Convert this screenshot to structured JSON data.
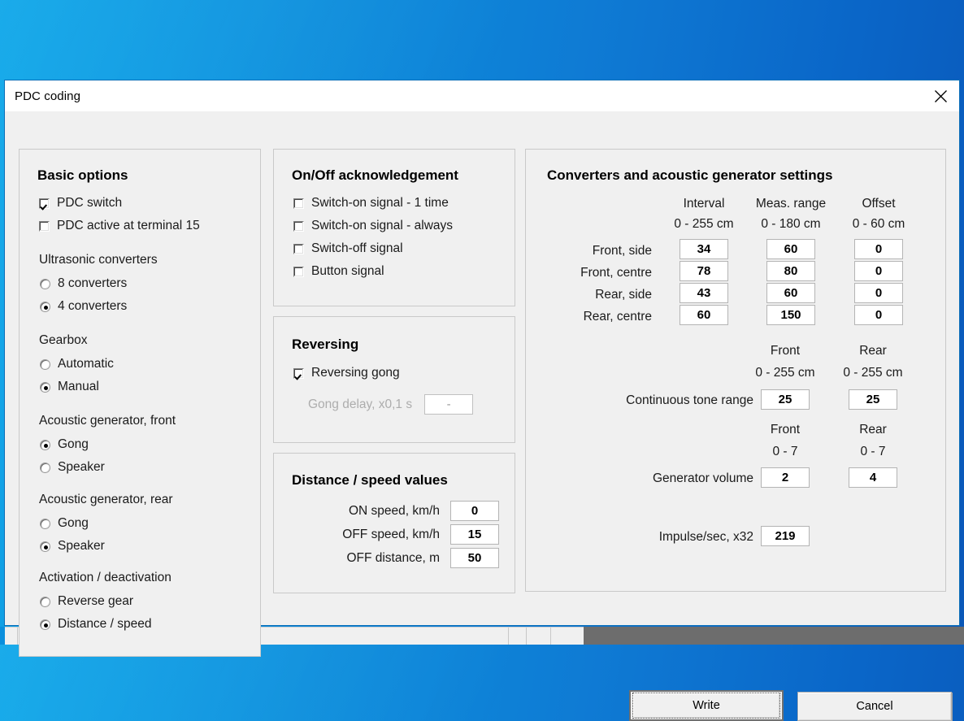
{
  "window": {
    "title": "PDC coding",
    "close_icon": "close-icon"
  },
  "basic_options": {
    "title": "Basic options",
    "checkboxes": [
      {
        "label": "PDC switch",
        "checked": true
      },
      {
        "label": "PDC active at terminal 15",
        "checked": false
      }
    ],
    "groups": [
      {
        "heading": "Ultrasonic converters",
        "options": [
          {
            "label": "8 converters",
            "selected": false
          },
          {
            "label": "4 converters",
            "selected": true
          }
        ]
      },
      {
        "heading": "Gearbox",
        "options": [
          {
            "label": "Automatic",
            "selected": false
          },
          {
            "label": "Manual",
            "selected": true
          }
        ]
      },
      {
        "heading": "Acoustic generator, front",
        "options": [
          {
            "label": "Gong",
            "selected": true
          },
          {
            "label": "Speaker",
            "selected": false
          }
        ]
      },
      {
        "heading": "Acoustic generator, rear",
        "options": [
          {
            "label": "Gong",
            "selected": false
          },
          {
            "label": "Speaker",
            "selected": true
          }
        ]
      },
      {
        "heading": "Activation / deactivation",
        "options": [
          {
            "label": "Reverse gear",
            "selected": false
          },
          {
            "label": "Distance / speed",
            "selected": true
          }
        ]
      }
    ]
  },
  "onoff": {
    "title": "On/Off acknowledgement",
    "checkboxes": [
      {
        "label": "Switch-on signal - 1 time",
        "checked": false
      },
      {
        "label": "Switch-on signal - always",
        "checked": false
      },
      {
        "label": "Switch-off signal",
        "checked": false
      },
      {
        "label": "Button signal",
        "checked": false
      }
    ]
  },
  "reversing": {
    "title": "Reversing",
    "checkbox": {
      "label": "Reversing gong",
      "checked": true
    },
    "gong_delay": {
      "label": "Gong delay, x0,1 s",
      "value": "-",
      "disabled": true
    }
  },
  "distance_speed": {
    "title": "Distance / speed values",
    "rows": [
      {
        "label": "ON speed, km/h",
        "value": "0"
      },
      {
        "label": "OFF speed, km/h",
        "value": "15"
      },
      {
        "label": "OFF distance, m",
        "value": "50"
      }
    ]
  },
  "converters": {
    "title": "Converters and acoustic generator settings",
    "columns": [
      {
        "name": "Interval",
        "range": "0 - 255 cm"
      },
      {
        "name": "Meas. range",
        "range": "0 - 180 cm"
      },
      {
        "name": "Offset",
        "range": "0 - 60 cm"
      }
    ],
    "rows": [
      {
        "label": "Front, side",
        "interval": "34",
        "meas_range": "60",
        "offset": "0"
      },
      {
        "label": "Front, centre",
        "interval": "78",
        "meas_range": "80",
        "offset": "0"
      },
      {
        "label": "Rear, side",
        "interval": "43",
        "meas_range": "60",
        "offset": "0"
      },
      {
        "label": "Rear, centre",
        "interval": "60",
        "meas_range": "150",
        "offset": "0"
      }
    ],
    "tone": {
      "label": "Continuous tone range",
      "col_front": "Front",
      "col_rear": "Rear",
      "range_front": "0 - 255 cm",
      "range_rear": "0 - 255 cm",
      "front": "25",
      "rear": "25"
    },
    "volume": {
      "label": "Generator volume",
      "col_front": "Front",
      "col_rear": "Rear",
      "range_front": "0 - 7",
      "range_rear": "0 - 7",
      "front": "2",
      "rear": "4"
    },
    "impulse": {
      "label": "Impulse/sec, x32",
      "value": "219"
    }
  },
  "buttons": {
    "write": "Write",
    "cancel": "Cancel"
  },
  "colors": {
    "desktop": "#0a8fdd",
    "dialog_bg": "#f0f0f0",
    "dialog_border": "#0b6fb8",
    "field_bg": "#ffffff",
    "disabled_text": "#adadad"
  }
}
